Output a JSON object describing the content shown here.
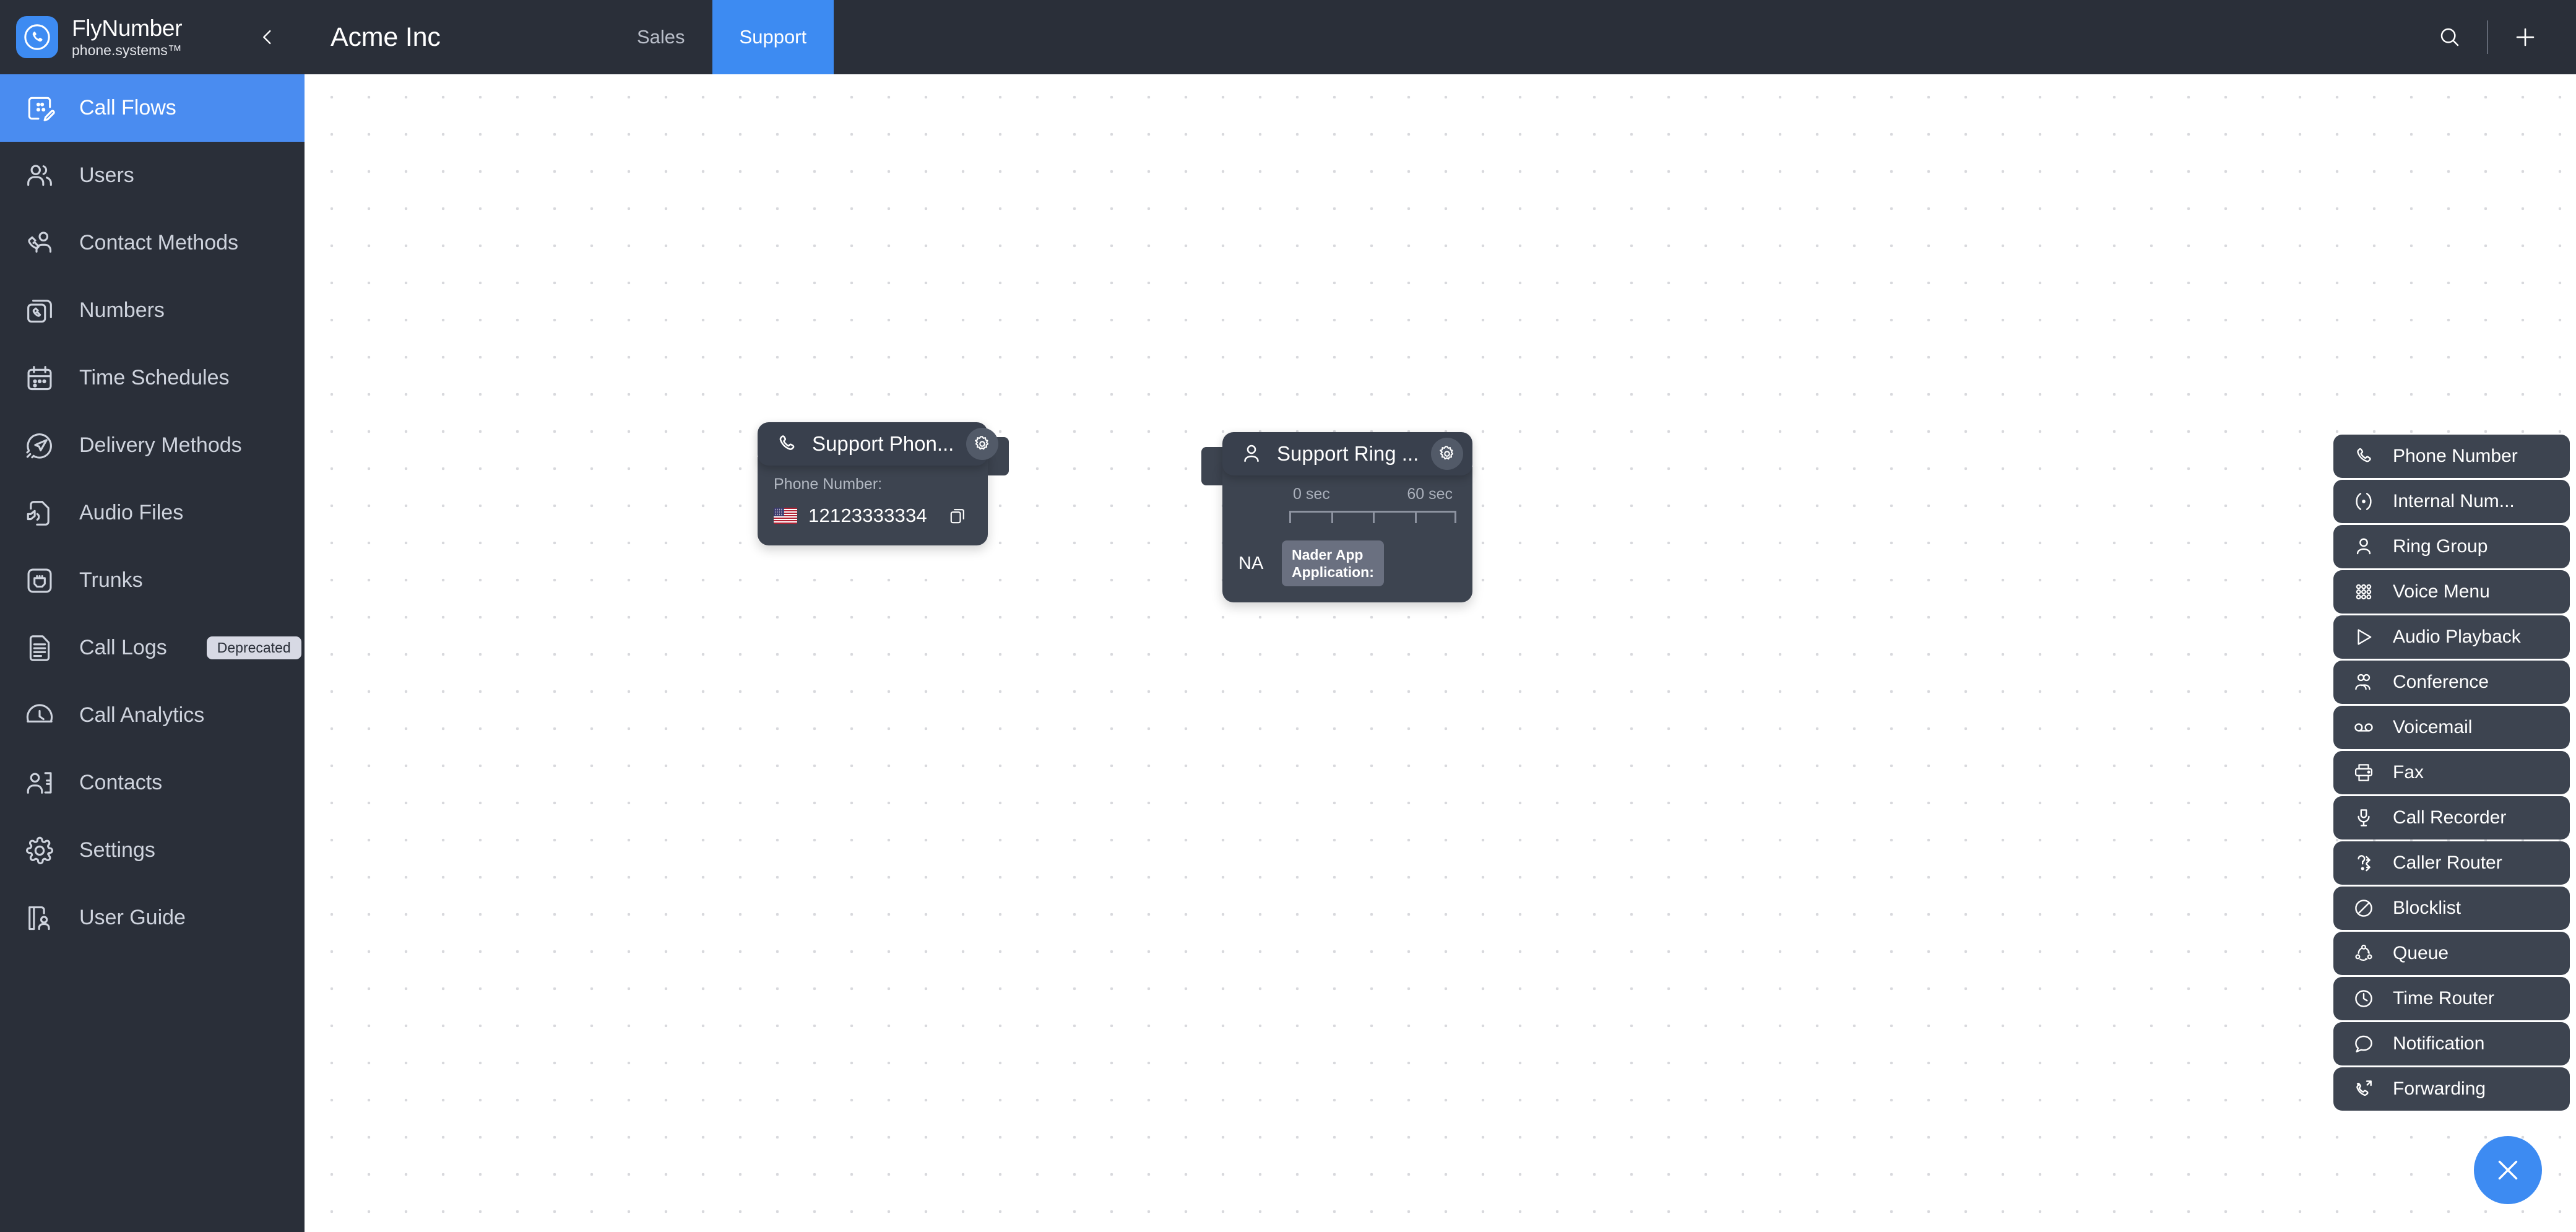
{
  "brand": {
    "name": "FlyNumber",
    "sub": "phone.systems™",
    "logo_icon": "phone-circle-icon",
    "accent": "#3d8bf2"
  },
  "sidebar": {
    "collapse_icon": "chevron-left-icon",
    "items": [
      {
        "label": "Call Flows",
        "icon": "call-flow-icon",
        "active": true
      },
      {
        "label": "Users",
        "icon": "users-icon",
        "active": false
      },
      {
        "label": "Contact Methods",
        "icon": "contact-method-icon",
        "active": false
      },
      {
        "label": "Numbers",
        "icon": "numbers-icon",
        "active": false
      },
      {
        "label": "Time Schedules",
        "icon": "calendar-icon",
        "active": false
      },
      {
        "label": "Delivery Methods",
        "icon": "delivery-icon",
        "active": false
      },
      {
        "label": "Audio Files",
        "icon": "audio-file-icon",
        "active": false
      },
      {
        "label": "Trunks",
        "icon": "trunk-icon",
        "active": false
      },
      {
        "label": "Call Logs",
        "icon": "document-icon",
        "active": false,
        "badge": "Deprecated"
      },
      {
        "label": "Call Analytics",
        "icon": "clock-analytics-icon",
        "active": false
      },
      {
        "label": "Contacts",
        "icon": "contact-card-icon",
        "active": false
      },
      {
        "label": "Settings",
        "icon": "gear-icon",
        "active": false
      }
    ],
    "footer": {
      "label": "User Guide",
      "icon": "user-guide-icon"
    }
  },
  "topbar": {
    "org_title": "Acme Inc",
    "tabs": [
      {
        "label": "Sales",
        "active": false
      },
      {
        "label": "Support",
        "active": true
      }
    ],
    "search_icon": "search-icon",
    "add_icon": "plus-icon"
  },
  "canvas": {
    "nodes": [
      {
        "type": "phone-number",
        "icon": "phone-icon",
        "title": "Support Phon...",
        "gear_icon": "gear-icon",
        "field_label": "Phone Number:",
        "flag_icon": "us-flag-icon",
        "phone_number": "12123333334",
        "copy_icon": "copy-icon"
      },
      {
        "type": "ring-group",
        "icon": "person-icon",
        "title": "Support Ring ...",
        "gear_icon": "gear-icon",
        "timeline_start": "0 sec",
        "timeline_end": "60 sec",
        "member_code": "NA",
        "member_chip_line1": "Nader App",
        "member_chip_line2": "Application:"
      }
    ]
  },
  "palette": {
    "items": [
      {
        "label": "Phone Number",
        "icon": "phone-icon"
      },
      {
        "label": "Internal Num...",
        "icon": "internal-number-icon"
      },
      {
        "label": "Ring Group",
        "icon": "person-icon"
      },
      {
        "label": "Voice Menu",
        "icon": "keypad-icon"
      },
      {
        "label": "Audio Playback",
        "icon": "play-icon"
      },
      {
        "label": "Conference",
        "icon": "conference-icon"
      },
      {
        "label": "Voicemail",
        "icon": "voicemail-icon"
      },
      {
        "label": "Fax",
        "icon": "fax-icon"
      },
      {
        "label": "Call Recorder",
        "icon": "microphone-icon"
      },
      {
        "label": "Caller Router",
        "icon": "caller-router-icon"
      },
      {
        "label": "Blocklist",
        "icon": "block-icon"
      },
      {
        "label": "Queue",
        "icon": "queue-icon"
      },
      {
        "label": "Time Router",
        "icon": "clock-icon"
      },
      {
        "label": "Notification",
        "icon": "chat-bubble-icon"
      },
      {
        "label": "Forwarding",
        "icon": "forward-call-icon"
      }
    ]
  },
  "fab": {
    "icon": "close-icon",
    "color": "#3d8bf2"
  }
}
